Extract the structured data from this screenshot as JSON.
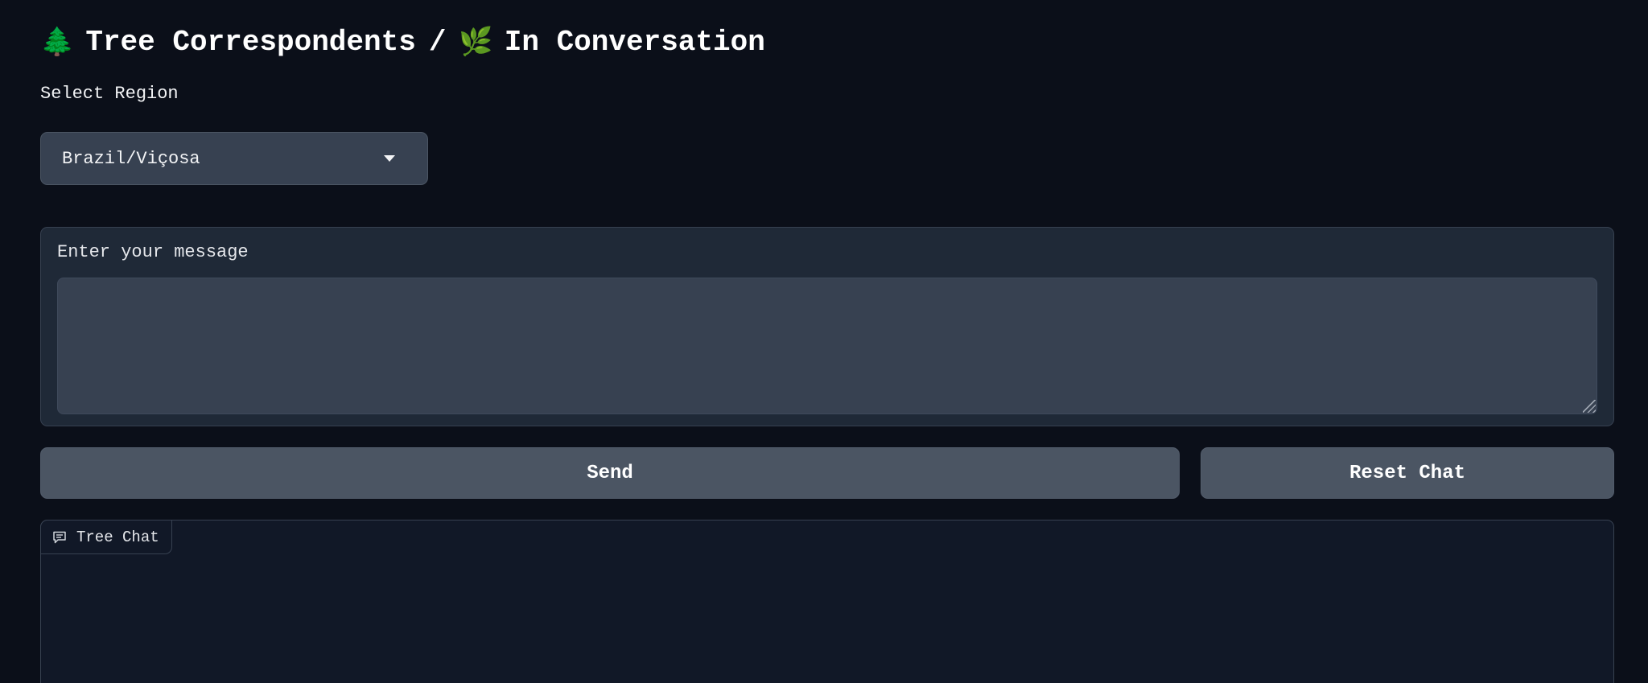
{
  "header": {
    "tree_emoji": "🌲",
    "title_left": "Tree Correspondents",
    "slash": "/",
    "herb_emoji": "🌿",
    "title_right": "In Conversation"
  },
  "region": {
    "label": "Select Region",
    "selected": "Brazil/Viçosa",
    "icon": "chevron-down-icon"
  },
  "message": {
    "label": "Enter your message",
    "value": "",
    "placeholder": ""
  },
  "buttons": {
    "send_label": "Send",
    "reset_label": "Reset Chat"
  },
  "chat": {
    "tab_label": "Tree Chat",
    "icon": "chat-icon"
  },
  "colors": {
    "background": "#0b0f19",
    "panel": "#1f2937",
    "input": "#374151",
    "button": "#4b5563",
    "text": "#ffffff"
  }
}
